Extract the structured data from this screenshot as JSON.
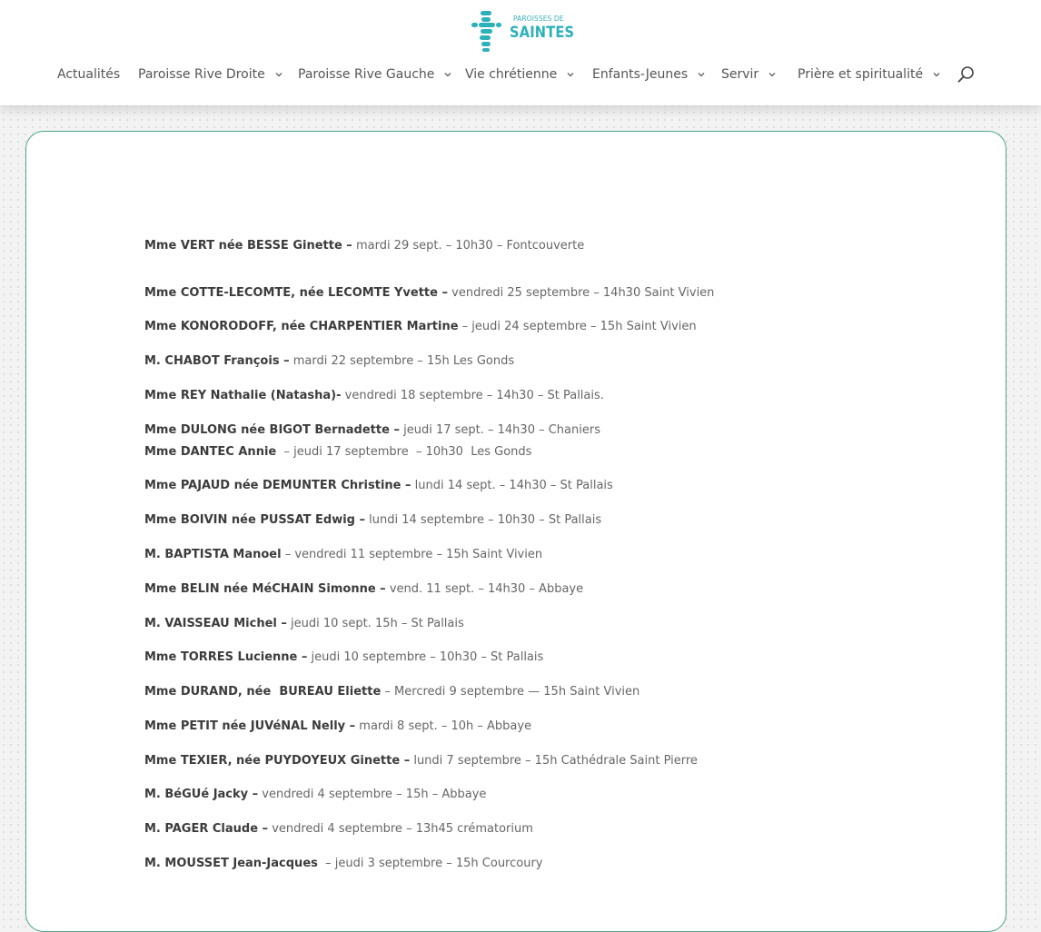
{
  "header": {
    "logo": {
      "small_text": "PAROISSES DE",
      "big_text": "SAINTES"
    },
    "nav": [
      {
        "label": "Actualités",
        "has_dropdown": false
      },
      {
        "label": "Paroisse Rive Droite",
        "has_dropdown": true
      },
      {
        "label": "Paroisse Rive Gauche",
        "has_dropdown": true
      },
      {
        "label": "Vie chrétienne",
        "has_dropdown": true
      },
      {
        "label": "Enfants-Jeunes",
        "has_dropdown": true
      },
      {
        "label": "Servir",
        "has_dropdown": true
      },
      {
        "label": "Prière et spiritualité",
        "has_dropdown": true
      }
    ],
    "search_icon": "search-icon"
  },
  "colors": {
    "brand": "#2cb1b9",
    "card_border": "#4da886",
    "text": "#666666",
    "name_text": "#3c3c3c"
  },
  "obituaries": [
    {
      "name": "Mme VERT née BESSE Ginette –",
      "details": " mardi 29 sept. – 10h30 – Fontcouverte"
    },
    {
      "name": "Mme COTTE-LECOMTE, née LECOMTE Yvette –",
      "details": " vendredi 25 septembre – 14h30 Saint Vivien"
    },
    {
      "name": "Mme KONORODOFF, née CHARPENTIER Martine",
      "details": " – jeudi 24 septembre – 15h Saint Vivien"
    },
    {
      "name": "M. CHABOT François –",
      "details": " mardi 22 septembre – 15h Les Gonds"
    },
    {
      "name": "Mme REY Nathalie (Natasha)-",
      "details": " vendredi 18 septembre – 14h30 – St Pallais."
    },
    {
      "name": "Mme DULONG née BIGOT Bernadette –",
      "details": " jeudi 17 sept. – 14h30 – Chaniers"
    },
    {
      "name": "Mme DANTEC Annie",
      "details": "  – jeudi 17 septembre  – 10h30  Les Gonds"
    },
    {
      "name": "Mme PAJAUD née DEMUNTER Christine –",
      "details": " lundi 14 sept. – 14h30 – St Pallais"
    },
    {
      "name": "Mme BOIVIN née PUSSAT Edwig –",
      "details": " lundi 14 septembre – 10h30 – St Pallais"
    },
    {
      "name": "M. BAPTISTA Manoel",
      "details": " – vendredi 11 septembre – 15h Saint Vivien"
    },
    {
      "name": "Mme BELIN née MéCHAIN Simonne –",
      "details": " vend. 11 sept. – 14h30 – Abbaye"
    },
    {
      "name": "M. VAISSEAU Michel –",
      "details": " jeudi 10 sept. 15h – St Pallais"
    },
    {
      "name": "Mme TORRES Lucienne –",
      "details": " jeudi 10 septembre – 10h30 – St Pallais"
    },
    {
      "name": "Mme DURAND, née  BUREAU Eliette",
      "details": " – Mercredi 9 septembre — 15h Saint Vivien"
    },
    {
      "name": "Mme PETIT née JUVéNAL Nelly –",
      "details": " mardi 8 sept. – 10h – Abbaye"
    },
    {
      "name": "Mme TEXIER, née PUYDOYEUX Ginette –",
      "details": " lundi 7 septembre – 15h Cathédrale Saint Pierre"
    },
    {
      "name": "M. BéGUé Jacky –",
      "details": " vendredi 4 septembre – 15h – Abbaye"
    },
    {
      "name": "M. PAGER Claude –",
      "details": " vendredi 4 septembre – 13h45 crématorium"
    },
    {
      "name": "M. MOUSSET Jean-Jacques",
      "details": "  – jeudi 3 septembre – 15h Courcoury"
    }
  ]
}
